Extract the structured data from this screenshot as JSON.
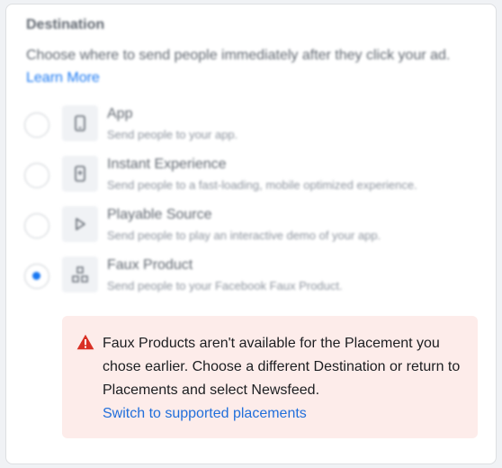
{
  "destination": {
    "title": "Destination",
    "description": "Choose where to send people immediately after they click your ad.",
    "learn_more": "Learn More",
    "options": [
      {
        "label": "App",
        "sublabel": "Send people to your app.",
        "icon": "phone-icon",
        "selected": false
      },
      {
        "label": "Instant Experience",
        "sublabel": "Send people to a fast-loading, mobile optimized experience.",
        "icon": "instant-experience-icon",
        "selected": false
      },
      {
        "label": "Playable Source",
        "sublabel": "Send people to play an interactive demo of your app.",
        "icon": "play-icon",
        "selected": false
      },
      {
        "label": "Faux Product",
        "sublabel": "Send people to your Facebook Faux Product.",
        "icon": "shapes-icon",
        "selected": true
      }
    ]
  },
  "warning": {
    "message": "Faux Products aren't available for the Placement you chose earlier. Choose a different Destination or return to Placements and select Newsfeed.",
    "link": "Switch to supported placements",
    "icon": "warning-triangle-icon"
  },
  "colors": {
    "accent": "#1877f2",
    "warning_bg": "#fdecea",
    "warning_icon": "#d93025"
  }
}
